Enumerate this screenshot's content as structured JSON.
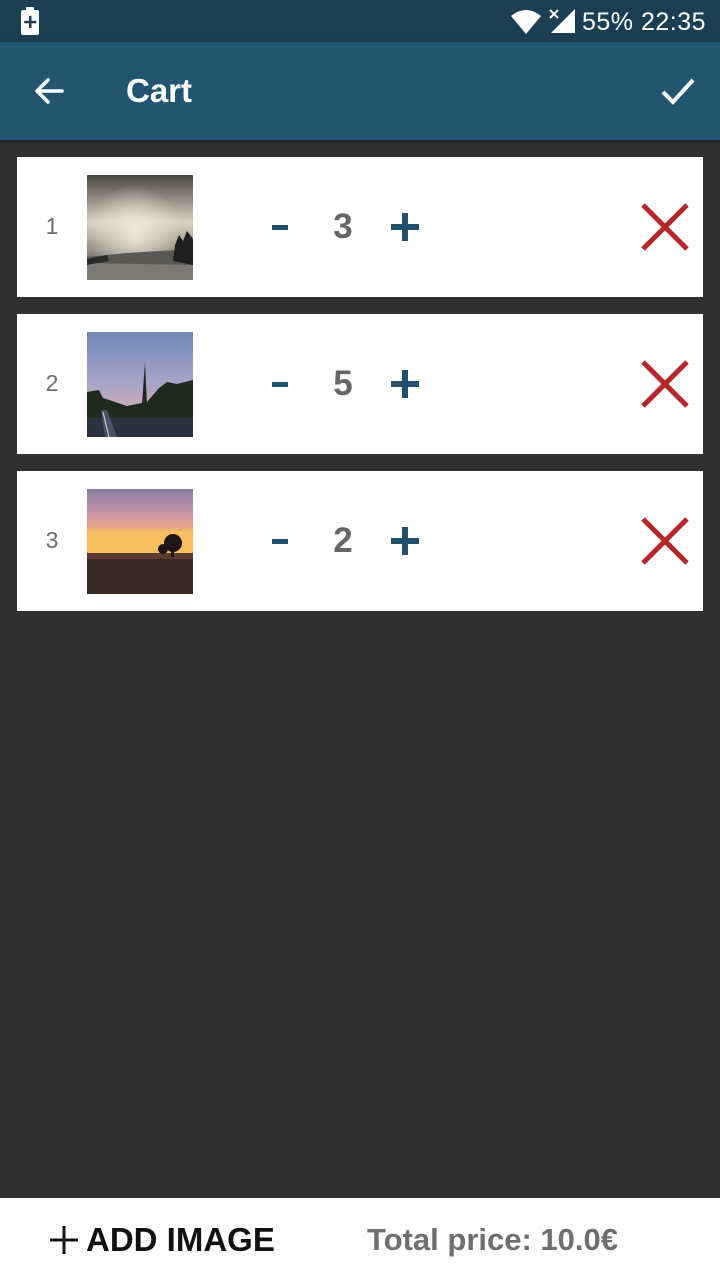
{
  "status_bar": {
    "battery_percent": "55%",
    "time": "22:35"
  },
  "app_bar": {
    "title": "Cart"
  },
  "cart_items": [
    {
      "index": "1",
      "quantity": "3",
      "thumbnail": "cloudy-road-photo"
    },
    {
      "index": "2",
      "quantity": "5",
      "thumbnail": "dusk-road-photo"
    },
    {
      "index": "3",
      "quantity": "2",
      "thumbnail": "sunset-field-photo"
    }
  ],
  "bottom_bar": {
    "add_image_label": "ADD IMAGE",
    "total_price": "Total price: 10.0€"
  },
  "colors": {
    "status_bar": "#1c3e52",
    "app_bar": "#225670",
    "background": "#303030",
    "stepper": "#23506b",
    "remove": "#b5252a"
  },
  "icons": [
    "battery-icon",
    "wifi-icon",
    "signal-icon",
    "back-arrow-icon",
    "checkmark-icon",
    "minus-icon",
    "plus-icon",
    "close-icon"
  ]
}
